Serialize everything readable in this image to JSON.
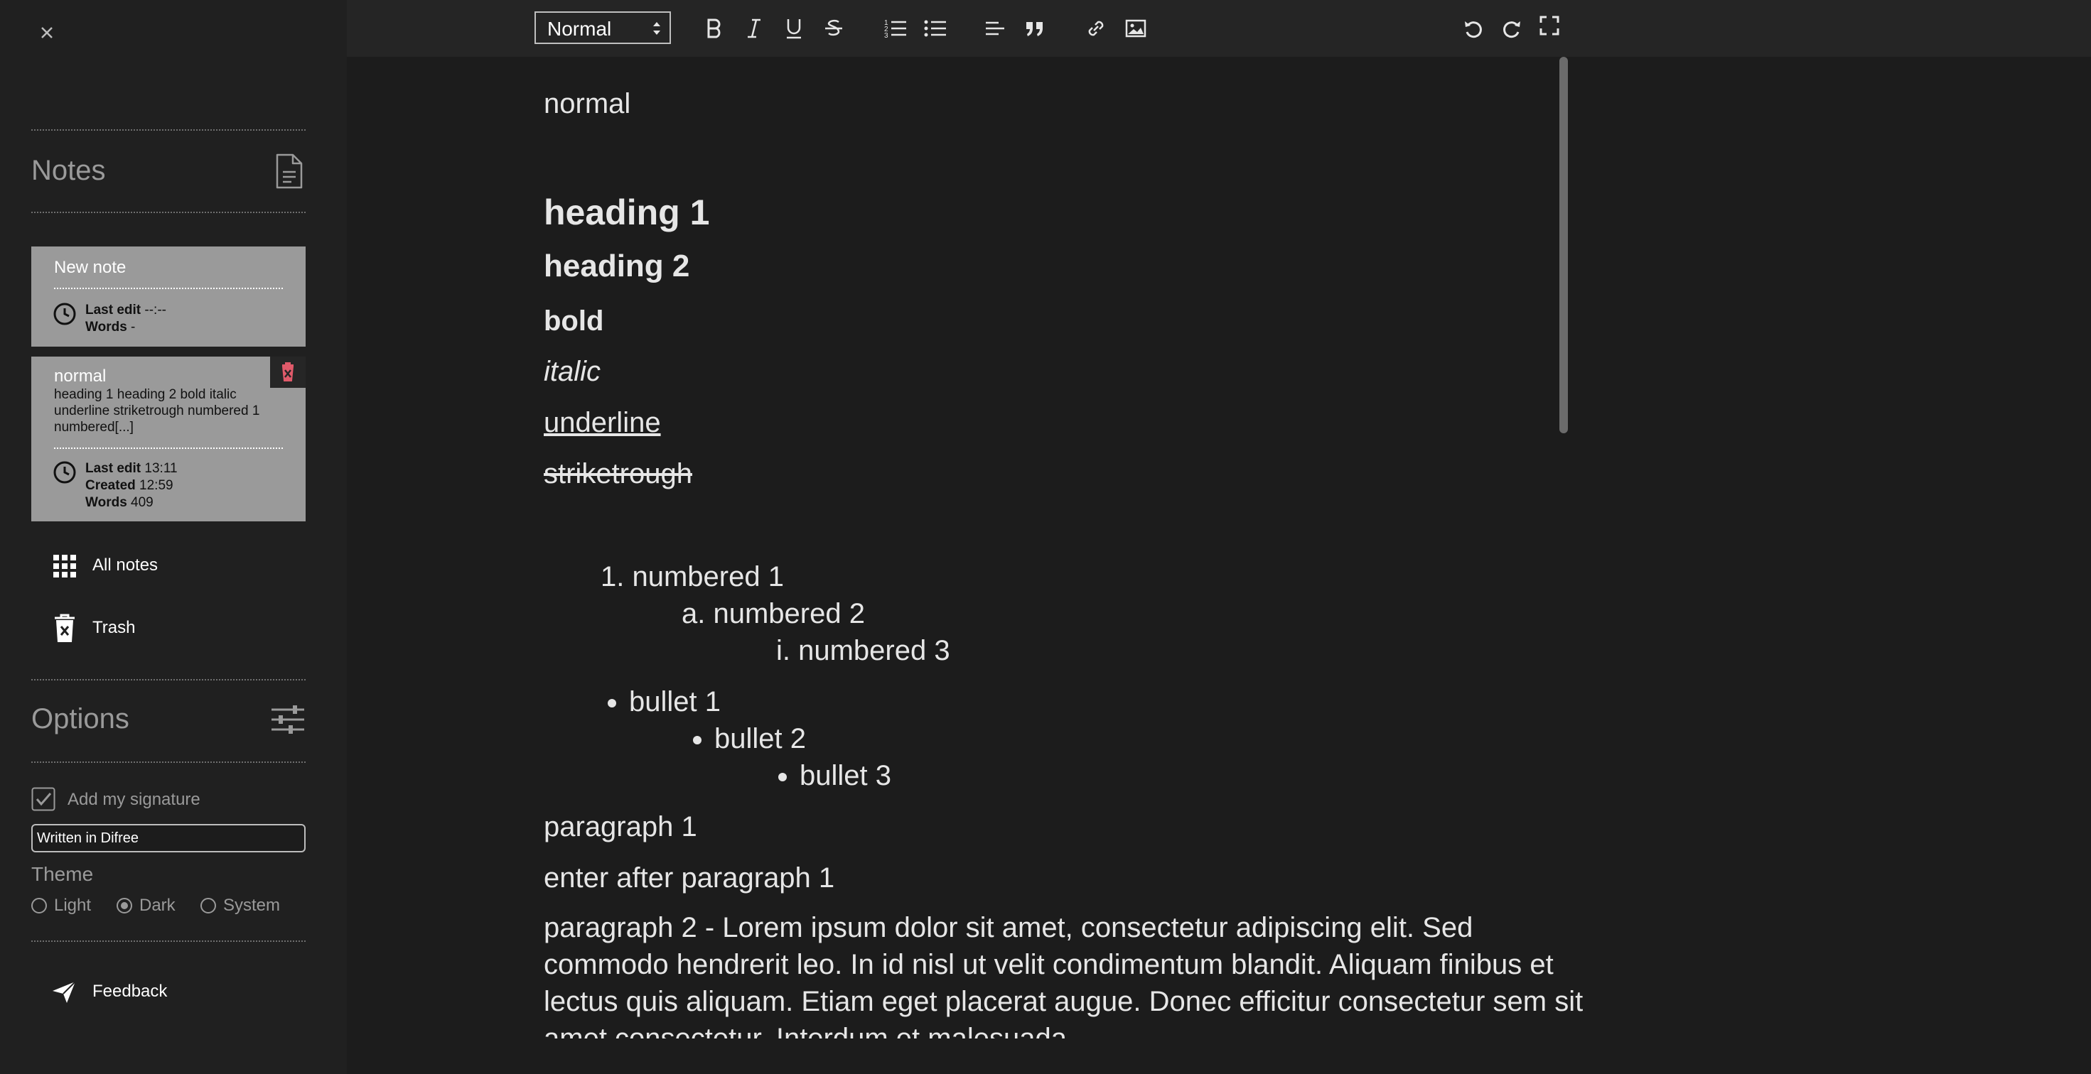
{
  "sidebar": {
    "notes_title": "Notes",
    "notes": [
      {
        "title": "New note",
        "preview": "",
        "last_edit_label": "Last edit",
        "last_edit": "--:--",
        "words_label": "Words",
        "words": "-"
      },
      {
        "title": "normal",
        "preview": "heading 1 heading 2 bold italic underline striketrough numbered 1 numbered[...]",
        "last_edit_label": "Last edit",
        "last_edit": "13:11",
        "created_label": "Created",
        "created": "12:59",
        "words_label": "Words",
        "words": "409"
      }
    ],
    "nav": [
      {
        "label": "All notes",
        "icon": "grid-icon"
      },
      {
        "label": "Trash",
        "icon": "trash-icon"
      }
    ],
    "options_title": "Options",
    "signature_label": "Add my signature",
    "signature_checked": true,
    "signature_value": "Written in Difree",
    "theme_label": "Theme",
    "themes": [
      "Light",
      "Dark",
      "System"
    ],
    "selected_theme": "Dark",
    "feedback_label": "Feedback"
  },
  "toolbar": {
    "format_value": "Normal",
    "buttons": [
      "bold",
      "italic",
      "underline",
      "strikethrough",
      "ordered-list",
      "bullet-list",
      "align-left",
      "blockquote",
      "link",
      "image",
      "undo",
      "redo",
      "fullscreen"
    ]
  },
  "editor": {
    "normal": "normal",
    "heading1": "heading 1",
    "heading2": "heading 2",
    "bold": "bold",
    "italic": "italic",
    "underline": "underline",
    "strike": "striketrough",
    "numbered": [
      "1. numbered 1",
      "a. numbered 2",
      "i. numbered 3"
    ],
    "bullets": [
      "bullet 1",
      "bullet 2",
      "bullet 3"
    ],
    "paragraph1": "paragraph 1",
    "enter_after": "enter after paragraph 1",
    "paragraph2": "paragraph 2 - Lorem ipsum dolor sit amet, consectetur adipiscing elit. Sed commodo hendrerit leo. In id nisl ut velit condimentum blandit. Aliquam finibus et lectus quis aliquam. Etiam eget placerat augue. Donec efficitur consectetur sem sit amet consectetur. Interdum et malesuada"
  },
  "colors": {
    "background": "#1c1c1c",
    "sidebar": "#202020",
    "card": "#9a9a9a",
    "delete_accent": "#e05a6a"
  }
}
